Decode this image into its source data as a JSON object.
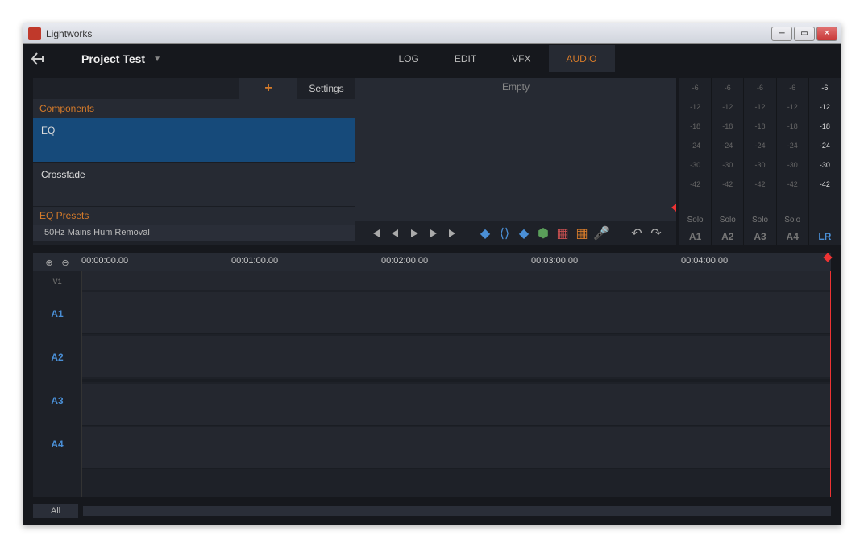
{
  "window": {
    "title": "Lightworks"
  },
  "project": {
    "name": "Project Test"
  },
  "main_tabs": {
    "log": "LOG",
    "edit": "EDIT",
    "vfx": "VFX",
    "audio": "AUDIO"
  },
  "left": {
    "plus": "+",
    "settings": "Settings",
    "components_header": "Components",
    "components": {
      "eq": "EQ",
      "crossfade": "Crossfade"
    },
    "presets_header": "EQ Presets",
    "preset1": "50Hz Mains Hum Removal"
  },
  "viewer": {
    "empty": "Empty"
  },
  "meters": {
    "db": [
      "-6",
      "-12",
      "-18",
      "-24",
      "-30",
      "-42"
    ],
    "solo": "Solo",
    "channels": {
      "a1": "A1",
      "a2": "A2",
      "a3": "A3",
      "a4": "A4",
      "lr": "LR"
    }
  },
  "ruler": {
    "t0": "00:00:00.00",
    "t1": "00:01:00.00",
    "t2": "00:02:00.00",
    "t3": "00:03:00.00",
    "t4": "00:04:00.00"
  },
  "tracks": {
    "v1": "V1",
    "a1": "A1",
    "a2": "A2",
    "a3": "A3",
    "a4": "A4"
  },
  "bottom": {
    "all": "All"
  }
}
